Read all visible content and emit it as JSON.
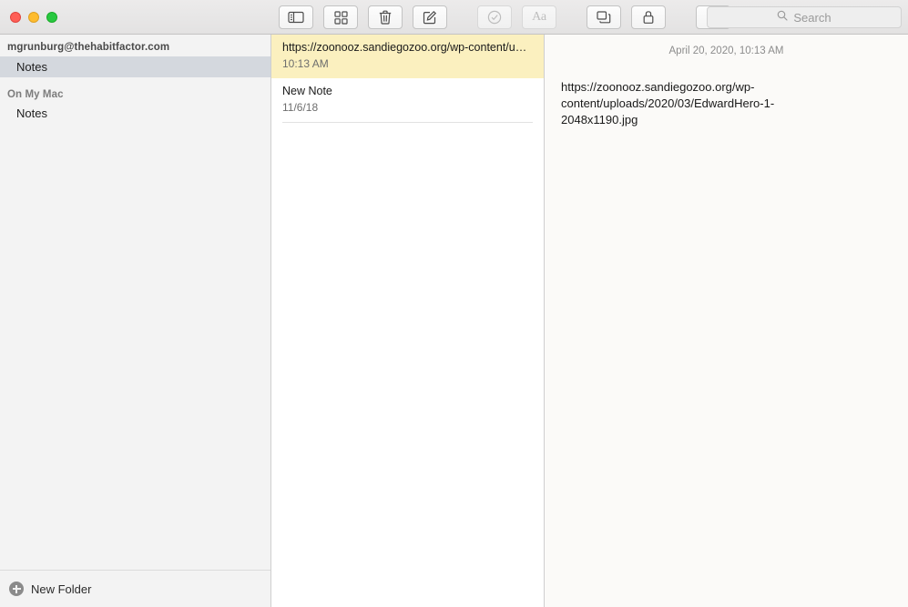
{
  "window": {
    "traffic_lights": {
      "close_label": "close-window",
      "minimize_label": "minimize-window",
      "maximize_label": "maximize-window",
      "close_color": "#ff5f57",
      "minimize_color": "#febc2e",
      "maximize_color": "#28c840"
    }
  },
  "toolbar": {
    "buttons": [
      {
        "name": "toggle-sidebar",
        "icon": "sidebar-icon",
        "label": "",
        "enabled": true
      },
      {
        "name": "gallery-view",
        "icon": "grid-icon",
        "label": "",
        "enabled": true
      },
      {
        "name": "delete-note",
        "icon": "trash-icon",
        "label": "",
        "enabled": true
      },
      {
        "name": "compose-note",
        "icon": "compose-icon",
        "label": "",
        "enabled": true
      },
      {
        "name": "checklist",
        "icon": "check-circle-icon",
        "label": "",
        "enabled": false
      },
      {
        "name": "text-format",
        "icon": "text-format-icon",
        "label": "Aa",
        "enabled": false
      },
      {
        "name": "insert-table",
        "icon": "table-icon",
        "label": "",
        "enabled": true
      },
      {
        "name": "lock-note",
        "icon": "lock-icon",
        "label": "",
        "enabled": true
      },
      {
        "name": "share-note",
        "icon": "share-icon",
        "label": "",
        "enabled": true
      }
    ],
    "search": {
      "placeholder": "Search",
      "value": "",
      "icon": "search-icon"
    }
  },
  "sidebar": {
    "account_header": "mgrunburg@thehabitfactor.com",
    "account_items": [
      {
        "label": "Notes",
        "selected": true
      }
    ],
    "local_header": "On My Mac",
    "local_items": [
      {
        "label": "Notes",
        "selected": false
      }
    ],
    "footer": {
      "new_folder_label": "New Folder",
      "icon": "plus-circle-icon"
    }
  },
  "note_list": {
    "items": [
      {
        "title": "https://zoonooz.sandiegozoo.org/wp-content/u…",
        "meta": "10:13 AM",
        "selected": true
      },
      {
        "title": "New Note",
        "meta": "11/6/18",
        "selected": false
      }
    ],
    "selected_highlight_color": "#fbf0bf"
  },
  "note_content": {
    "date": "April 20, 2020, 10:13 AM",
    "body": "https://zoonooz.sandiegozoo.org/wp-content/uploads/2020/03/EdwardHero-1-2048x1190.jpg"
  }
}
